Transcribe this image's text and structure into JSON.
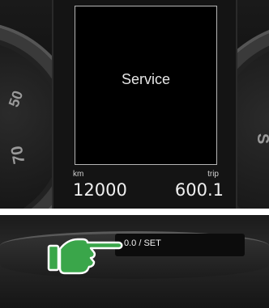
{
  "display": {
    "message": "Service",
    "odometer_label": "km",
    "odometer_value": "12000",
    "trip_label": "trip",
    "trip_value": "600.1"
  },
  "gauges": {
    "left_tick_1": "50",
    "left_tick_2": "70",
    "right_tick": "S"
  },
  "control": {
    "button_label": "0.0 / SET",
    "pointer_color": "#3aa64a"
  }
}
